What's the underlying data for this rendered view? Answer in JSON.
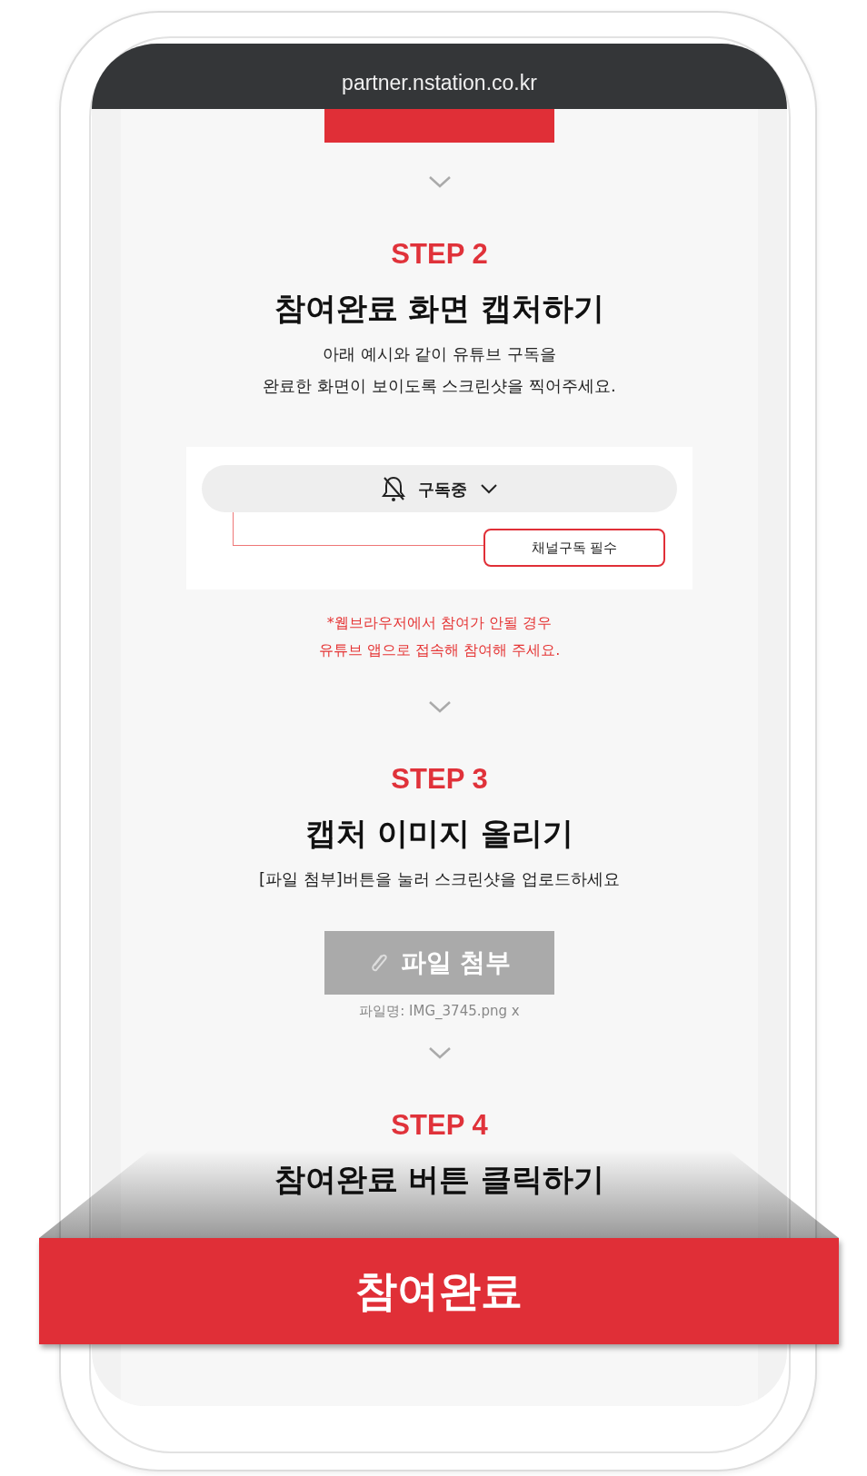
{
  "browser": {
    "address": "partner.nstation.co.kr"
  },
  "steps": [
    {
      "label": "STEP 2",
      "title": "참여완료 화면 캡처하기",
      "description": "아래 예시와 같이 유튜브 구독을\n완료한 화면이 보이도록 스크린샷을 찍어주세요.",
      "example": {
        "button_label": "구독중",
        "callout": "채널구독 필수"
      },
      "note": "*웹브라우저에서 참여가 안될 경우\n유튜브 앱으로 접속해 참여해 주세요."
    },
    {
      "label": "STEP 3",
      "title": "캡처 이미지 올리기",
      "description": "[파일 첨부]버튼을 눌러 스크린샷을 업로드하세요",
      "upload": {
        "button_label": "파일 첨부",
        "disabled": true,
        "file_name": "파일명: IMG_3745.png x"
      }
    },
    {
      "label": "STEP 4",
      "title": "참여완료 버튼 클릭하기"
    }
  ],
  "submit_button": {
    "label": "참여완료"
  }
}
